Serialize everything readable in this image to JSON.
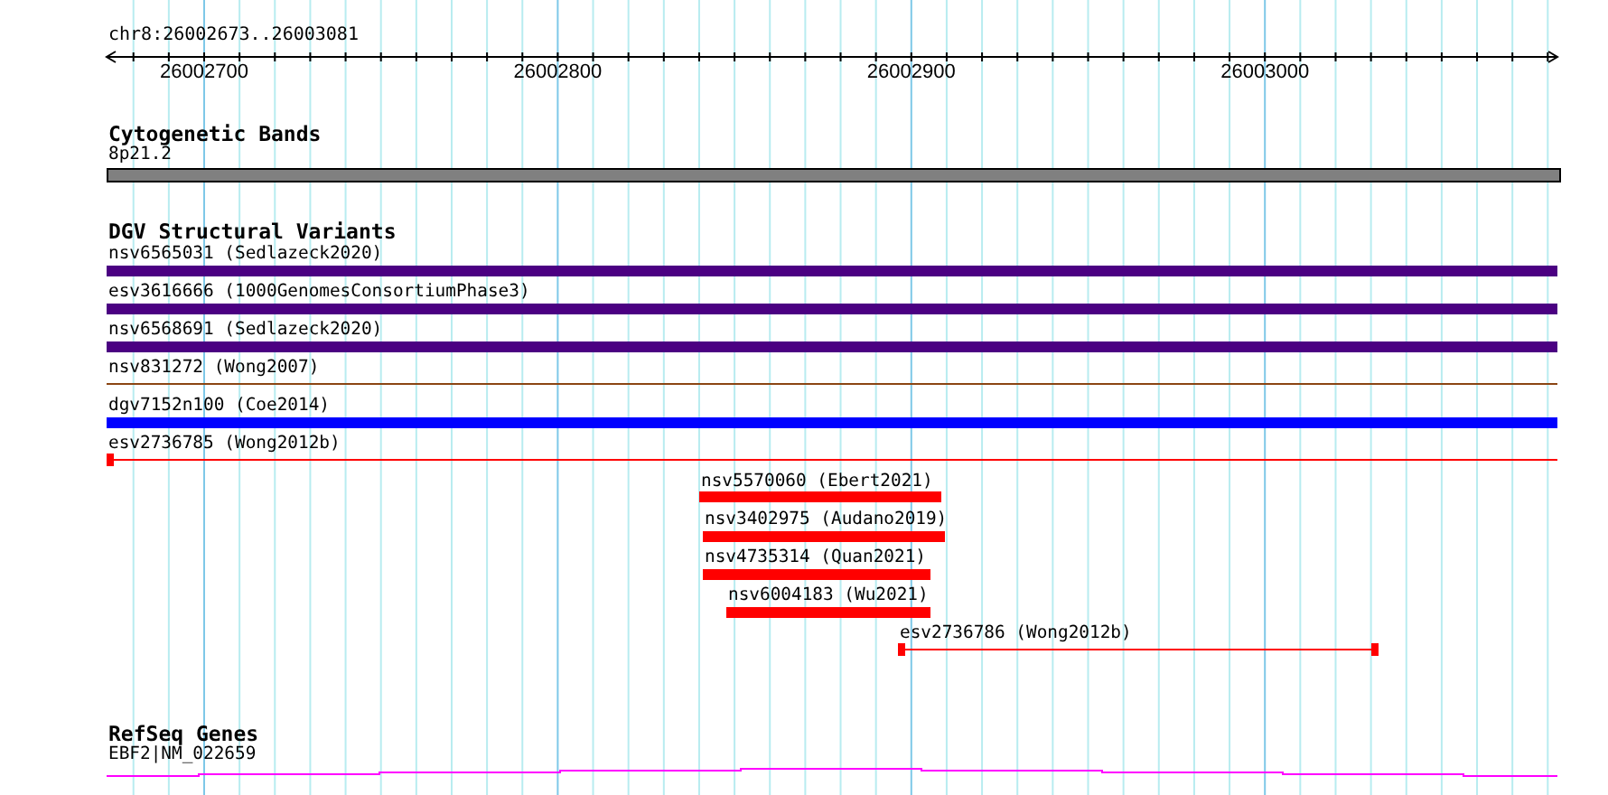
{
  "ruler": {
    "location": "chr8:26002673..26003081",
    "ticks": [
      "26002700",
      "26002800",
      "26002900",
      "26003000"
    ]
  },
  "tracks": [
    {
      "title": "Cytogenetic Bands",
      "kind": "cytoband",
      "features": [
        {
          "label": "8p21.2",
          "color": "#808080"
        }
      ]
    },
    {
      "title": "DGV Structural Variants",
      "kind": "variants",
      "features": [
        {
          "label": "nsv6565031 (Sedlazeck2020)",
          "kind": "bar",
          "color": "#4b0082"
        },
        {
          "label": "esv3616666 (1000GenomesConsortiumPhase3)",
          "kind": "bar",
          "color": "#4b0082"
        },
        {
          "label": "nsv6568691 (Sedlazeck2020)",
          "kind": "bar",
          "color": "#4b0082"
        },
        {
          "label": "nsv831272 (Wong2007)",
          "kind": "line",
          "color": "#8b4513"
        },
        {
          "label": "dgv7152n100 (Coe2014)",
          "kind": "bar",
          "color": "#0000ff"
        },
        {
          "label": "esv2736785 (Wong2012b)",
          "kind": "interval",
          "color": "#ff0000"
        },
        {
          "label": "nsv5570060 (Ebert2021)",
          "kind": "bar",
          "color": "#ff0000"
        },
        {
          "label": "nsv3402975 (Audano2019)",
          "kind": "bar",
          "color": "#ff0000"
        },
        {
          "label": "nsv4735314 (Quan2021)",
          "kind": "bar",
          "color": "#ff0000"
        },
        {
          "label": "nsv6004183 (Wu2021)",
          "kind": "bar",
          "color": "#ff0000"
        },
        {
          "label": "esv2736786 (Wong2012b)",
          "kind": "interval",
          "color": "#ff0000"
        }
      ]
    },
    {
      "title": "RefSeq Genes",
      "kind": "genes",
      "features": [
        {
          "label": "EBF2|NM_022659",
          "kind": "gene",
          "color": "#ff00ff"
        }
      ]
    }
  ]
}
